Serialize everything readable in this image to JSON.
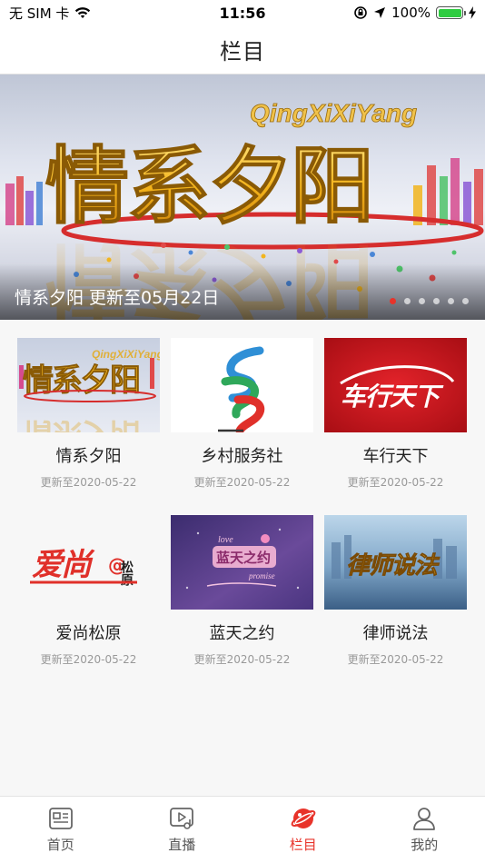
{
  "status_bar": {
    "carrier": "无 SIM 卡",
    "time": "11:56",
    "battery_percent": "100%",
    "battery_level": 1.0
  },
  "nav": {
    "title": "栏目"
  },
  "banner": {
    "caption": "情系夕阳 更新至05月22日",
    "art_title": "情系夕阳",
    "art_subtitle": "QingXiXiYang",
    "dot_count": 6,
    "active_dot": 0
  },
  "programs": [
    {
      "title": "情系夕阳",
      "date": "更新至2020-05-22",
      "thumb_text": "情系夕阳",
      "thumb_sub": "QingXiXiYang"
    },
    {
      "title": "乡村服务社",
      "date": "更新至2020-05-22",
      "thumb_text": "",
      "thumb_sub": ""
    },
    {
      "title": "车行天下",
      "date": "更新至2020-05-22",
      "thumb_text": "车行天下",
      "thumb_sub": ""
    },
    {
      "title": "爱尚松原",
      "date": "更新至2020-05-22",
      "thumb_text": "爱尚",
      "thumb_sub": "松原"
    },
    {
      "title": "蓝天之约",
      "date": "更新至2020-05-22",
      "thumb_text": "蓝天之约",
      "thumb_sub": "love",
      "thumb_sub2": "promise"
    },
    {
      "title": "律师说法",
      "date": "更新至2020-05-22",
      "thumb_text": "律师说法",
      "thumb_sub": ""
    }
  ],
  "tabs": [
    {
      "label": "首页",
      "icon": "news-icon"
    },
    {
      "label": "直播",
      "icon": "play-icon"
    },
    {
      "label": "栏目",
      "icon": "planet-icon"
    },
    {
      "label": "我的",
      "icon": "person-icon"
    }
  ],
  "active_tab": 2,
  "colors": {
    "accent": "#e8332a",
    "banner_gold": "#f2b51e"
  }
}
